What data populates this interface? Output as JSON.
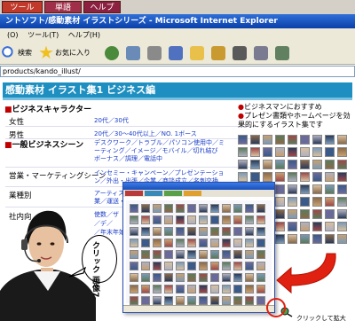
{
  "top_menu": {
    "tabs": [
      {
        "label": "ツール"
      },
      {
        "label": "単語"
      },
      {
        "label": "ヘルプ"
      }
    ]
  },
  "ie": {
    "window_title": "ントソフト/感動素材 イラストシリーズ - Microsoft Internet Explorer",
    "menu": [
      "(O)",
      "ツール(T)",
      "ヘルプ(H)"
    ],
    "toolbar": {
      "search_label": "検索",
      "favorites_label": "お気に入り"
    },
    "address": "products/kando_illust/"
  },
  "page": {
    "banner": "感動素材 イラスト集1 ビジネス編",
    "section1": "ビジネスキャラクター",
    "female_label": "女性",
    "female_val": "20代／30代",
    "male_label": "男性",
    "male_val": "20代／30〜40代以上／NO. 1ボース",
    "section2": "一般ビジネスシーン",
    "general_val": "デスクワーク／トラブル／パソコン使用中／ミーティング／イメージ／モバイル／切れ結び ボーナス／調理／電話中",
    "sales_label": "営業・マーケティングシーン",
    "sales_val": "インセミー・キャンペーン／プレゼンテーション／外出・出張／企業／商談成立／名刺交換",
    "industry_label": "業種別",
    "industry_val": "アーティスト／サービス業／医療・介護／飲食業／運送・運輸／",
    "internal_label": "社内向",
    "internal_val1": "使数／ザ",
    "internal_val2": "／デ／",
    "internal_val3": "／年末年始",
    "note1": "ビジネスマンにおすすめ",
    "note2": "プレゼン書類やホームページを効果的にするイラスト集です"
  },
  "popup": {
    "zoom_label": "クリックして拡大"
  },
  "bubble": {
    "text": "クリック 画像7"
  },
  "colors": {
    "menu_tab_1": "#c0392b",
    "menu_tab_2": "#a0304a",
    "menu_tab_3": "#8b2040",
    "banner": "#1e8fc0",
    "link": "#1a3cc8",
    "bullet": "#c00000",
    "arrow": "#e02010"
  }
}
